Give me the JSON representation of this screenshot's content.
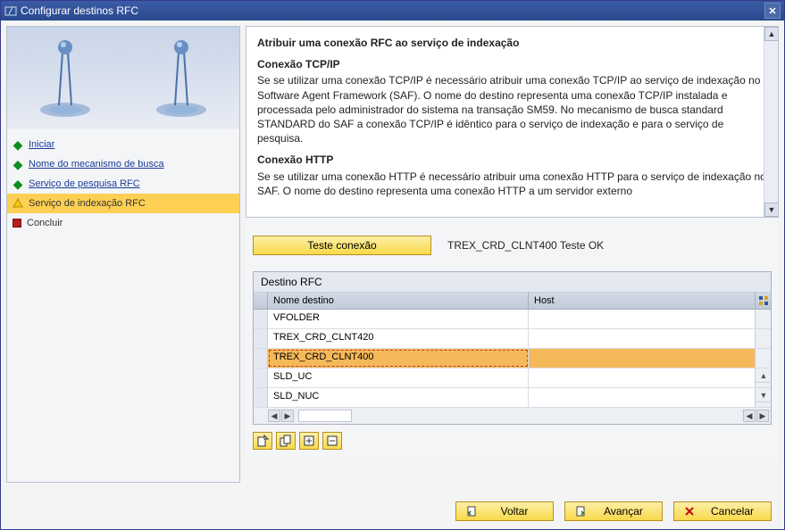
{
  "window": {
    "title": "Configurar destinos RFC"
  },
  "sidebar": {
    "items": [
      {
        "label": "Iniciar",
        "status": "green",
        "link": true,
        "active": false
      },
      {
        "label": "Nome do mecanismo de busca",
        "status": "green",
        "link": true,
        "active": false
      },
      {
        "label": "Serviço de pesquisa RFC",
        "status": "green",
        "link": true,
        "active": false
      },
      {
        "label": "Serviço de indexação RFC",
        "status": "yellow",
        "link": false,
        "active": true
      },
      {
        "label": "Concluir",
        "status": "red",
        "link": false,
        "active": false
      }
    ]
  },
  "info": {
    "heading": "Atribuir uma conexão RFC ao serviço de indexação",
    "sub1_title": "Conexão TCP/IP",
    "sub1_text": "Se se utilizar uma conexão TCP/IP é necessário atribuir uma conexão TCP/IP ao serviço de indexação no Software Agent Framework (SAF). O nome do destino representa uma conexão TCP/IP instalada e processada pelo administrador do sistema na transação SM59. No mecanismo de busca standard STANDARD do SAF a conexão TCP/IP é idêntico para o serviço de indexação e para o serviço de pesquisa.",
    "sub2_title": "Conexão HTTP",
    "sub2_text": "Se se utilizar uma conexão HTTP é necessário atribuir uma conexão HTTP para o serviço de indexação no SAF. O nome do destino representa uma conexão HTTP a um servidor externo"
  },
  "controls": {
    "test_button": "Teste conexão",
    "status_text": "TREX_CRD_CLNT400 Teste OK"
  },
  "table": {
    "title": "Destino RFC",
    "columns": {
      "name": "Nome destino",
      "host": "Host"
    },
    "rows": [
      {
        "name": "VFOLDER",
        "host": "",
        "selected": false
      },
      {
        "name": "TREX_CRD_CLNT420",
        "host": "",
        "selected": false
      },
      {
        "name": "TREX_CRD_CLNT400",
        "host": "",
        "selected": true
      },
      {
        "name": "SLD_UC",
        "host": "",
        "selected": false
      },
      {
        "name": "SLD_NUC",
        "host": "",
        "selected": false
      }
    ]
  },
  "bottom": {
    "back": "Voltar",
    "next": "Avançar",
    "cancel": "Cancelar"
  }
}
